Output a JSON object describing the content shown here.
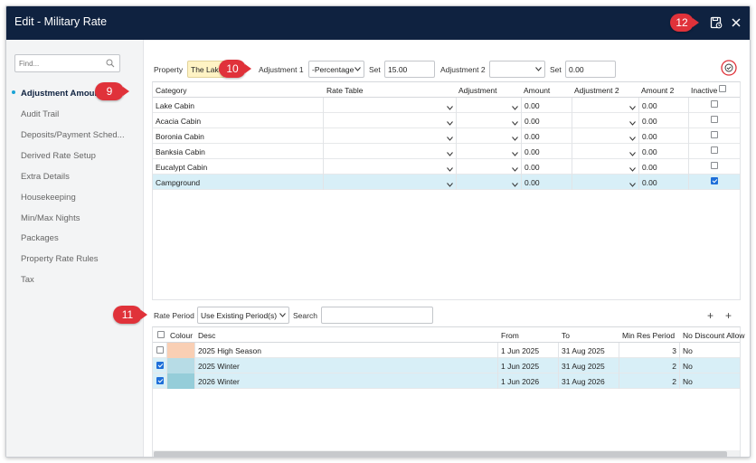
{
  "window": {
    "title": "Edit - Military Rate"
  },
  "callouts": {
    "c9": "9",
    "c10": "10",
    "c11": "11",
    "c12": "12"
  },
  "sidebar": {
    "find_placeholder": "Find...",
    "items": [
      {
        "label": "Adjustment Amount"
      },
      {
        "label": "Audit Trail"
      },
      {
        "label": "Deposits/Payment Sched..."
      },
      {
        "label": "Derived Rate Setup"
      },
      {
        "label": "Extra Details"
      },
      {
        "label": "Housekeeping"
      },
      {
        "label": "Min/Max Nights"
      },
      {
        "label": "Packages"
      },
      {
        "label": "Property Rate Rules"
      },
      {
        "label": "Tax"
      }
    ]
  },
  "filters": {
    "property_label": "Property",
    "property_value": "The Lake",
    "adj1_label": "Adjustment 1",
    "adj1_value": "-Percentage",
    "set1_label": "Set",
    "set1_value": "15.00",
    "adj2_label": "Adjustment 2",
    "adj2_value": "",
    "set2_label": "Set",
    "set2_value": "0.00"
  },
  "rates_grid": {
    "headers": [
      "Category",
      "Rate Table",
      "Adjustment",
      "Amount",
      "Adjustment 2",
      "Amount 2",
      "Inactive"
    ],
    "rows": [
      {
        "category": "Lake Cabin",
        "amount": "0.00",
        "amount2": "0.00",
        "inactive": false
      },
      {
        "category": "Acacia Cabin",
        "amount": "0.00",
        "amount2": "0.00",
        "inactive": false
      },
      {
        "category": "Boronia Cabin",
        "amount": "0.00",
        "amount2": "0.00",
        "inactive": false
      },
      {
        "category": "Banksia Cabin",
        "amount": "0.00",
        "amount2": "0.00",
        "inactive": false
      },
      {
        "category": "Eucalypt Cabin",
        "amount": "0.00",
        "amount2": "0.00",
        "inactive": false
      },
      {
        "category": "Campground",
        "amount": "0.00",
        "amount2": "0.00",
        "inactive": true
      }
    ]
  },
  "period_bar": {
    "rate_period_label": "Rate Period",
    "rate_period_value": "Use Existing Period(s)",
    "search_label": "Search",
    "search_value": "",
    "add1": "+",
    "add2": "+"
  },
  "periods_grid": {
    "headers": [
      "Colour",
      "Desc",
      "From",
      "To",
      "Min Res Period",
      "No Discount Allow"
    ],
    "rows": [
      {
        "checked": false,
        "colour": "#f9cfb4",
        "desc": "2025 High Season",
        "from": "1 Jun 2025",
        "to": "31 Aug 2025",
        "min": "3",
        "nodisc": "No"
      },
      {
        "checked": true,
        "colour": "#b7dce6",
        "desc": "2025 Winter",
        "from": "1 Jun 2025",
        "to": "31 Aug 2025",
        "min": "2",
        "nodisc": "No"
      },
      {
        "checked": true,
        "colour": "#95cdd9",
        "desc": "2026 Winter",
        "from": "1 Jun 2026",
        "to": "31 Aug 2026",
        "min": "2",
        "nodisc": "No"
      }
    ]
  },
  "colors": {
    "titlebar": "#0f2240",
    "badge": "#e0323a",
    "selected_row": "#d8eff7",
    "checkbox_on": "#1e6fd9"
  }
}
